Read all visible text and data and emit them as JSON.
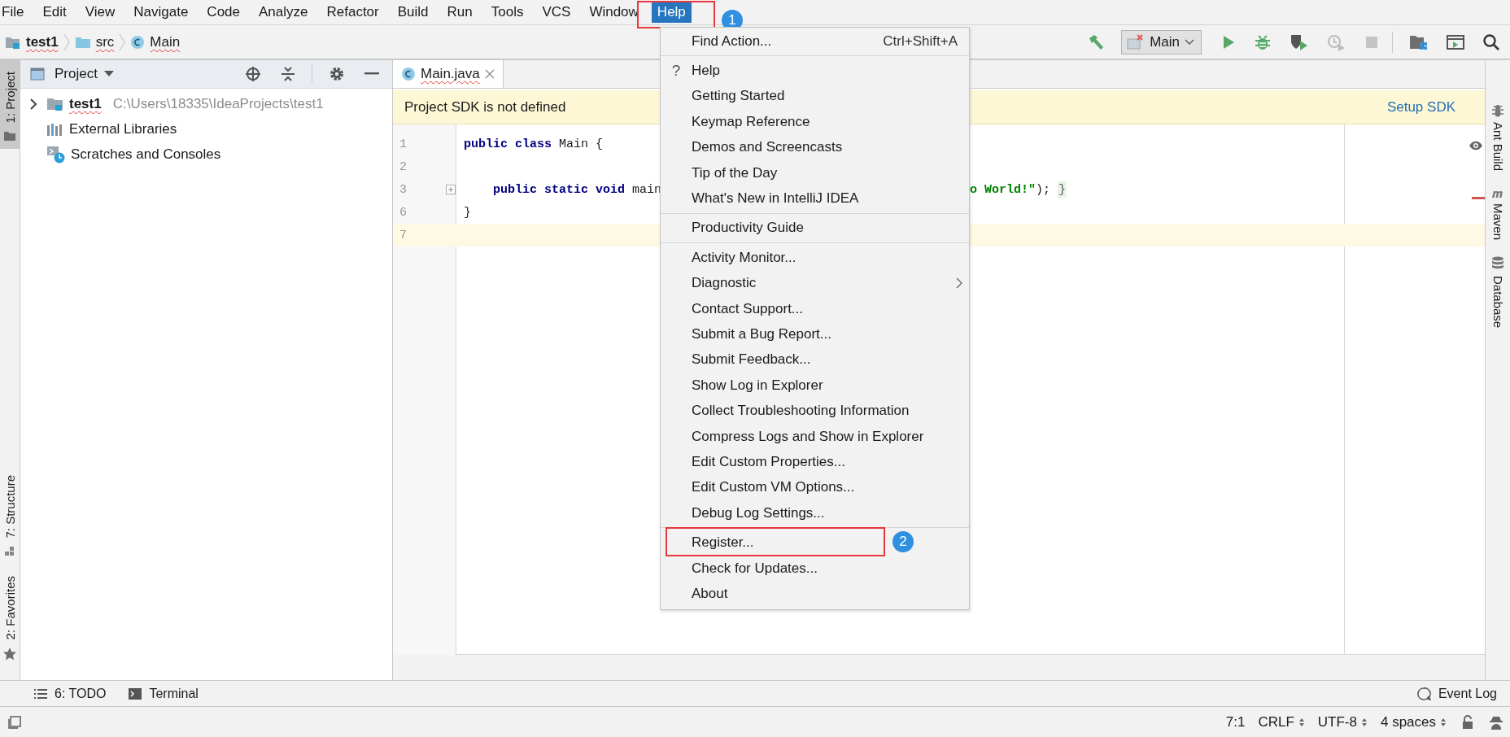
{
  "menu_bar": [
    {
      "label": "File",
      "selected": false
    },
    {
      "label": "Edit",
      "selected": false
    },
    {
      "label": "View",
      "selected": false
    },
    {
      "label": "Navigate",
      "selected": false
    },
    {
      "label": "Code",
      "selected": false
    },
    {
      "label": "Analyze",
      "selected": false
    },
    {
      "label": "Refactor",
      "selected": false
    },
    {
      "label": "Build",
      "selected": false
    },
    {
      "label": "Run",
      "selected": false
    },
    {
      "label": "Tools",
      "selected": false
    },
    {
      "label": "VCS",
      "selected": false
    },
    {
      "label": "Window",
      "selected": false
    },
    {
      "label": "Help",
      "selected": true,
      "callout": "1"
    }
  ],
  "navigation_bar": {
    "breadcrumbs": [
      {
        "label": "test1",
        "kind": "module",
        "error": true
      },
      {
        "label": "src",
        "kind": "folder",
        "error": true
      },
      {
        "label": "Main",
        "kind": "class",
        "error": true
      }
    ],
    "run_configuration": "Main"
  },
  "left_tool_windows": [
    {
      "label": "1: Project",
      "kind": "project",
      "selected": true
    }
  ],
  "left_bottom_tool_windows": [
    {
      "label": "7: Structure",
      "kind": "structure",
      "selected": false
    },
    {
      "label": "2: Favorites",
      "kind": "favorites",
      "selected": false
    }
  ],
  "project_panel": {
    "title": "Project",
    "tree": [
      {
        "label": "test1",
        "path": "C:\\Users\\18335\\IdeaProjects\\test1",
        "kind": "module",
        "expanded": false,
        "error": true
      },
      {
        "label": "External Libraries",
        "kind": "libraries",
        "error": false
      },
      {
        "label": "Scratches and Consoles",
        "kind": "scratches",
        "error": false
      }
    ]
  },
  "editor": {
    "tabs": [
      {
        "label": "Main.java",
        "selected": true,
        "error": true
      }
    ],
    "banner": {
      "message": "Project SDK is not defined",
      "action": "Setup SDK"
    },
    "lines": [
      {
        "number": "1",
        "current": false,
        "folded": false,
        "tokens": [
          {
            "text": "public class",
            "kind": "keyword"
          },
          {
            "text": " Main {",
            "kind": "plain"
          }
        ]
      },
      {
        "number": "2",
        "current": false,
        "folded": false
      },
      {
        "number": "3",
        "current": false,
        "folded": true,
        "tokens": [
          {
            "text": "    public static void",
            "kind": "keyword"
          },
          {
            "text": " main",
            "kind": "plain"
          }
        ],
        "trailing_tokens": [
          {
            "text": "o World!\"",
            "kind": "string"
          },
          {
            "text": ");",
            "kind": "plain"
          },
          {
            "text": "}",
            "kind": "fold"
          }
        ]
      },
      {
        "number": "6",
        "current": false,
        "folded": false,
        "tokens": [
          {
            "text": "}",
            "kind": "plain"
          }
        ]
      },
      {
        "number": "7",
        "current": true,
        "folded": false
      }
    ],
    "error_stripe": true
  },
  "right_tool_windows": [
    {
      "label": "Ant Build",
      "kind": "ant"
    },
    {
      "label": "Maven",
      "kind": "maven"
    },
    {
      "label": "Database",
      "kind": "database"
    }
  ],
  "help_menu": [
    {
      "kind": "item",
      "label": "Find Action...",
      "shortcut": "Ctrl+Shift+A"
    },
    {
      "kind": "separator"
    },
    {
      "kind": "item",
      "label": "Help",
      "icon": "?"
    },
    {
      "kind": "item",
      "label": "Getting Started"
    },
    {
      "kind": "item",
      "label": "Keymap Reference"
    },
    {
      "kind": "item",
      "label": "Demos and Screencasts"
    },
    {
      "kind": "item",
      "label": "Tip of the Day"
    },
    {
      "kind": "item",
      "label": "What's New in IntelliJ IDEA"
    },
    {
      "kind": "separator"
    },
    {
      "kind": "item",
      "label": "Productivity Guide"
    },
    {
      "kind": "separator"
    },
    {
      "kind": "item",
      "label": "Activity Monitor..."
    },
    {
      "kind": "item",
      "label": "Diagnostic",
      "submenu": true
    },
    {
      "kind": "item",
      "label": "Contact Support..."
    },
    {
      "kind": "item",
      "label": "Submit a Bug Report..."
    },
    {
      "kind": "item",
      "label": "Submit Feedback..."
    },
    {
      "kind": "item",
      "label": "Show Log in Explorer"
    },
    {
      "kind": "item",
      "label": "Collect Troubleshooting Information"
    },
    {
      "kind": "item",
      "label": "Compress Logs and Show in Explorer"
    },
    {
      "kind": "item",
      "label": "Edit Custom Properties..."
    },
    {
      "kind": "item",
      "label": "Edit Custom VM Options..."
    },
    {
      "kind": "item",
      "label": "Debug Log Settings..."
    },
    {
      "kind": "separator"
    },
    {
      "kind": "item",
      "label": "Register...",
      "callout": "2"
    },
    {
      "kind": "item",
      "label": "Check for Updates..."
    },
    {
      "kind": "item",
      "label": "About"
    }
  ],
  "bottom_tool_windows": [
    {
      "label": "6: TODO",
      "kind": "todo"
    },
    {
      "label": "Terminal",
      "kind": "terminal"
    }
  ],
  "event_log": "Event Log",
  "status_bar": [
    "7:1",
    "CRLF",
    "UTF-8",
    "4 spaces"
  ]
}
